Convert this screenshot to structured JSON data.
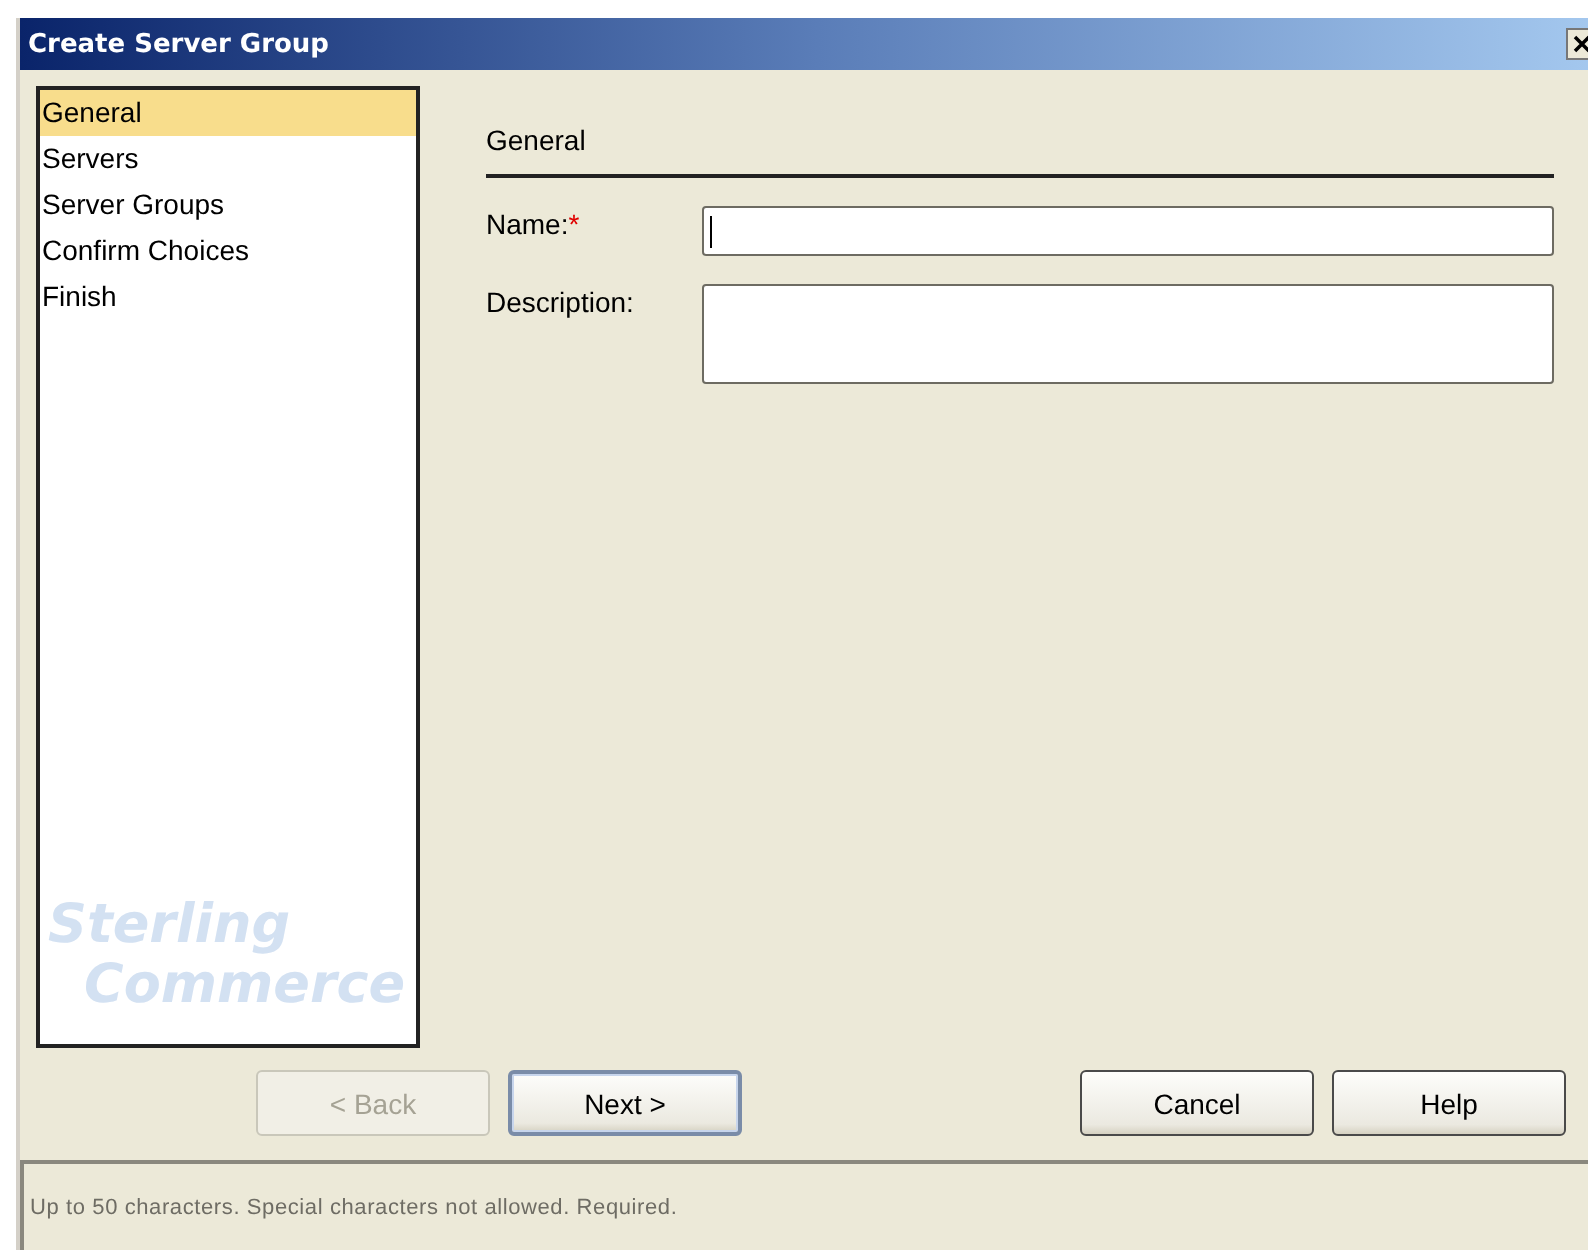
{
  "window": {
    "title": "Create Server Group"
  },
  "steps": [
    {
      "label": "General",
      "selected": true
    },
    {
      "label": "Servers",
      "selected": false
    },
    {
      "label": "Server Groups",
      "selected": false
    },
    {
      "label": "Confirm Choices",
      "selected": false
    },
    {
      "label": "Finish",
      "selected": false
    }
  ],
  "logo": {
    "line_1": "Sterling",
    "line_2": "Commerce"
  },
  "section": {
    "title": "General"
  },
  "fields": [
    {
      "label": "Name:",
      "required_mark": "*",
      "kind": "line",
      "focused": true
    },
    {
      "label": "Description:",
      "kind": "area",
      "focused": false
    }
  ],
  "buttons": [
    {
      "label": "< Back",
      "disabled": true,
      "default": false
    },
    {
      "label": "Next >",
      "disabled": false,
      "default": true
    },
    {
      "label": "Cancel",
      "disabled": false,
      "default": false
    },
    {
      "label": "Help",
      "disabled": false,
      "default": false
    }
  ],
  "status_bar": {
    "text": "Up to 50 characters. Special characters not allowed. Required."
  }
}
